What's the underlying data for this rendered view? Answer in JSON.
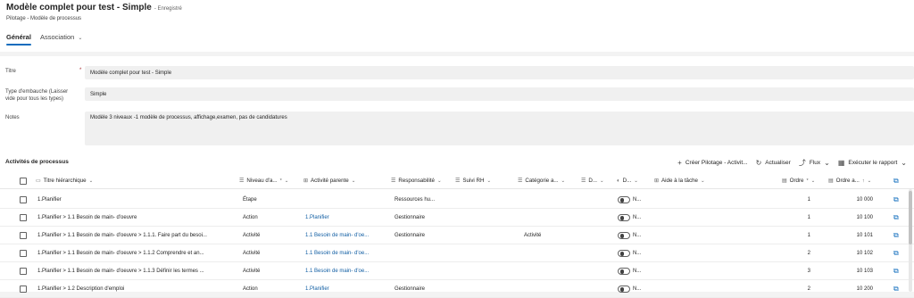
{
  "header": {
    "title": "Modèle complet pour test - Simple",
    "saved_status": "- Enregistré",
    "subtitle": "Pilotage - Modèle de processus",
    "tabs": [
      {
        "label": "Général"
      },
      {
        "label": "Association",
        "chevron": "⌄"
      }
    ]
  },
  "form": {
    "titre_label": "Titre",
    "required_mark": "*",
    "titre_value": "Modèle complet pour test - Simple",
    "type_label_line1": "Type d'embauche (Laisser",
    "type_label_line2": "vide pour tous les types)",
    "type_value": "Simple",
    "notes_label": "Notes",
    "notes_value": "Modèle 3 niveaux -1 modèle de processus, affichage,examen, pas de candidatures"
  },
  "grid": {
    "title": "Activités de processus",
    "commands": {
      "create_icon": "+",
      "create_label": "Créer Pilotage - Activit...",
      "refresh_icon": "↻",
      "refresh_label": "Actualiser",
      "flow_icon": "⤴",
      "flow_label": "Flux",
      "flow_chevron": "⌄",
      "report_icon": "▦",
      "report_label": "Exécuter le rapport",
      "report_chevron": "⌄"
    },
    "columns": {
      "titre": "Titre hiérarchique",
      "niveau": "Niveau d'a...",
      "parente": "Activité parente",
      "responsabilite": "Responsabilité",
      "suivi": "Suivi RH",
      "categorie": "Catégorie a...",
      "d1": "D...",
      "d2": "D...",
      "aide": "Aide à la tâche",
      "ordre": "Ordre",
      "ordre_a": "Ordre a...",
      "sort_arrow": "↑",
      "chevron": "⌄",
      "req": "*"
    },
    "rows": [
      {
        "titre": "1.Planifier",
        "niveau": "Étape",
        "parente": "",
        "responsabilite": "Ressources hu...",
        "categorie": "",
        "toggle": "N...",
        "ordre": "1",
        "ordre_a": "10 000"
      },
      {
        "titre": "1.Planifier > 1.1 Besoin de main- d'oeuvre",
        "niveau": "Action",
        "parente": "1.Planifier",
        "responsabilite": "Gestionnaire",
        "categorie": "",
        "toggle": "N...",
        "ordre": "1",
        "ordre_a": "10 100"
      },
      {
        "titre": "1.Planifier > 1.1 Besoin de main- d'oeuvre > 1.1.1. Faire part du besoi...",
        "niveau": "Activité",
        "parente": "1.1 Besoin de main- d'oe...",
        "responsabilite": "Gestionnaire",
        "categorie": "Activité",
        "toggle": "N...",
        "ordre": "1",
        "ordre_a": "10 101"
      },
      {
        "titre": "1.Planifier > 1.1 Besoin de main- d'oeuvre > 1.1.2 Comprendre et an...",
        "niveau": "Activité",
        "parente": "1.1 Besoin de main- d'oe...",
        "responsabilite": "",
        "categorie": "",
        "toggle": "N...",
        "ordre": "2",
        "ordre_a": "10 102"
      },
      {
        "titre": "1.Planifier > 1.1 Besoin de main- d'oeuvre > 1.1.3 Définir les termes ...",
        "niveau": "Activité",
        "parente": "1.1 Besoin de main- d'oe...",
        "responsabilite": "",
        "categorie": "",
        "toggle": "N...",
        "ordre": "3",
        "ordre_a": "10 103"
      },
      {
        "titre": "1.Planifier > 1.2 Description d'emploi",
        "niveau": "Action",
        "parente": "1.Planifier",
        "responsabilite": "Gestionnaire",
        "categorie": "",
        "toggle": "N...",
        "ordre": "2",
        "ordre_a": "10 200"
      }
    ]
  }
}
